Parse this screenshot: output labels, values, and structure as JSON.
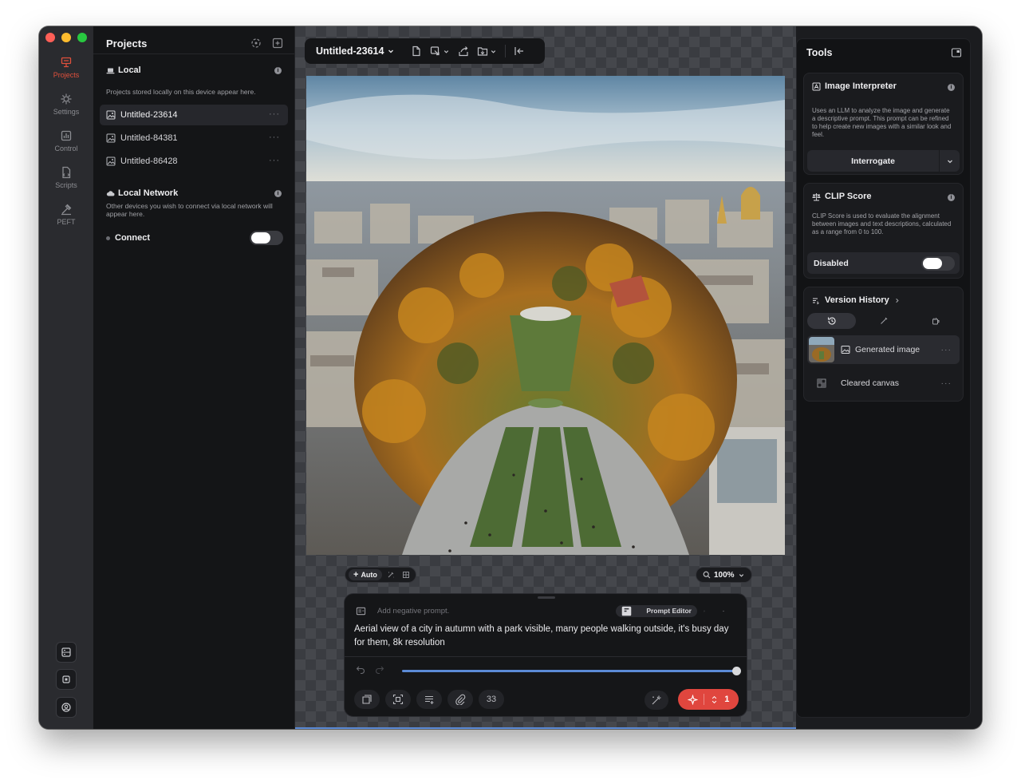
{
  "rail": {
    "items": [
      {
        "label": "Projects",
        "icon": "projects-icon",
        "active": true
      },
      {
        "label": "Settings",
        "icon": "settings-icon",
        "active": false
      },
      {
        "label": "Control",
        "icon": "control-icon",
        "active": false
      },
      {
        "label": "Scripts",
        "icon": "scripts-icon",
        "active": false
      },
      {
        "label": "PEFT",
        "icon": "peft-icon",
        "active": false
      }
    ]
  },
  "projects": {
    "title": "Projects",
    "local": {
      "title": "Local",
      "description": "Projects stored locally on this device appear here.",
      "items": [
        {
          "name": "Untitled-23614",
          "selected": true
        },
        {
          "name": "Untitled-84381",
          "selected": false
        },
        {
          "name": "Untitled-86428",
          "selected": false
        }
      ]
    },
    "network": {
      "title": "Local Network",
      "description": "Other devices you wish to connect via local network will appear here.",
      "connect_label": "Connect",
      "connect_on": false
    }
  },
  "toolbar": {
    "doc_title": "Untitled-23614"
  },
  "canvas": {
    "auto_label": "Auto",
    "zoom_label": "100%"
  },
  "prompt": {
    "negative_placeholder": "Add negative prompt.",
    "prompt_editor_label": "Prompt Editor",
    "text": "Aerial view of a city in autumn with a park visible, many people walking outside, it's busy day for them, 8k resolution",
    "strength": 1.0,
    "steps": "33",
    "generate_count": "1"
  },
  "tools": {
    "title": "Tools",
    "image_interpreter": {
      "title": "Image Interpreter",
      "description": "Uses an LLM to analyze the image and generate a descriptive prompt. This prompt can be refined to help create new images with a similar look and feel.",
      "button": "Interrogate"
    },
    "clip_score": {
      "title": "CLIP Score",
      "description": "CLIP Score is used to evaluate the alignment between images and text descriptions, calculated as a range from 0 to 100.",
      "status": "Disabled",
      "enabled": false
    },
    "version_history": {
      "title": "Version History",
      "items": [
        {
          "label": "Generated image",
          "selected": true
        },
        {
          "label": "Cleared canvas",
          "selected": false
        }
      ]
    }
  },
  "colors": {
    "accent": "#e0503c",
    "generate": "#e0463e",
    "slider": "#5b8ad6"
  }
}
